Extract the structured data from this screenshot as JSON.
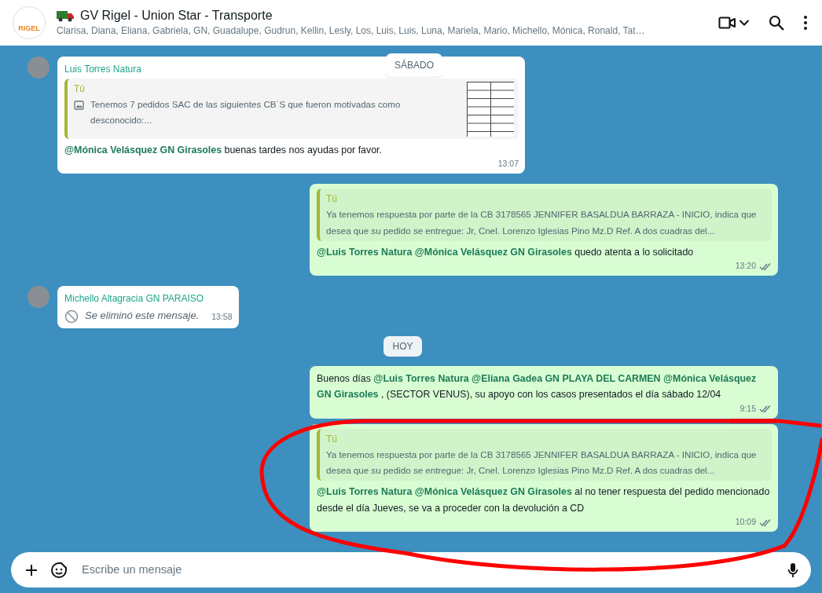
{
  "header": {
    "logo_text": "RIGEL",
    "title": "GV Rigel - Union Star - Transporte",
    "members": "Clarisa, Diana, Eliana, Gabriela, GN, Guadalupe, Gudrun, Kellin, Lesly, Los, Luis, Luis, Luna, Mariela, Mario, Michello, Mónica, Ronald, Tat…"
  },
  "floating_date": "SÁBADO",
  "messages": [
    {
      "kind": "incoming",
      "sender": "Luis Torres Natura",
      "quote": {
        "author": "Tú",
        "has_image": true,
        "text": "Tenemos 7 pedidos SAC de las siguientes CB´S que fueron motivadas como desconocido:..."
      },
      "text": "**@Mónica Velásquez GN Girasoles** buenas tardes nos ayudas por favor.",
      "time": "13:07"
    },
    {
      "kind": "outgoing",
      "quote": {
        "author": "Tú",
        "has_image": false,
        "text": "Ya tenemos respuesta por parte de la CB 3178565 JENNIFER BASALDUA BARRAZA - INICIO, indica que desea que su pedido se entregue: Jr, Cnel. Lorenzo Iglesias Pino Mz.D Ref. A dos cuadras del..."
      },
      "text": "**@Luis Torres Natura @Mónica Velásquez GN Girasoles** quedo atenta a lo solicitado",
      "time": "13:20",
      "read": false
    },
    {
      "kind": "deleted",
      "sender": "Michello Altagracia GN PARAISO",
      "text": "Se eliminó este mensaje.",
      "time": "13:58"
    },
    {
      "kind": "date",
      "text": "HOY"
    },
    {
      "kind": "outgoing",
      "text": "Buenos días **@Luis Torres Natura @Eliana Gadea GN PLAYA DEL CARMEN @Mónica Velásquez GN Girasoles** , (SECTOR VENUS), su apoyo con los casos presentados el día sábado 12/04",
      "time": "9:15",
      "read": false
    },
    {
      "kind": "outgoing",
      "quote": {
        "author": "Tú",
        "has_image": false,
        "text": "Ya tenemos respuesta por parte de la CB 3178565 JENNIFER BASALDUA BARRAZA - INICIO, indica que desea que su pedido se entregue: Jr, Cnel. Lorenzo Iglesias Pino Mz.D Ref. A dos cuadras del..."
      },
      "text": "**@Luis Torres Natura @Mónica Velásquez GN Girasoles** al no tener respuesta del pedido mencionado desde el día Jueves, se va a proceder con la devolución a CD",
      "time": "10:09",
      "read": false
    }
  ],
  "composer": {
    "placeholder": "Escribe un mensaje"
  },
  "annotation": {
    "kind": "freehand-circle"
  }
}
